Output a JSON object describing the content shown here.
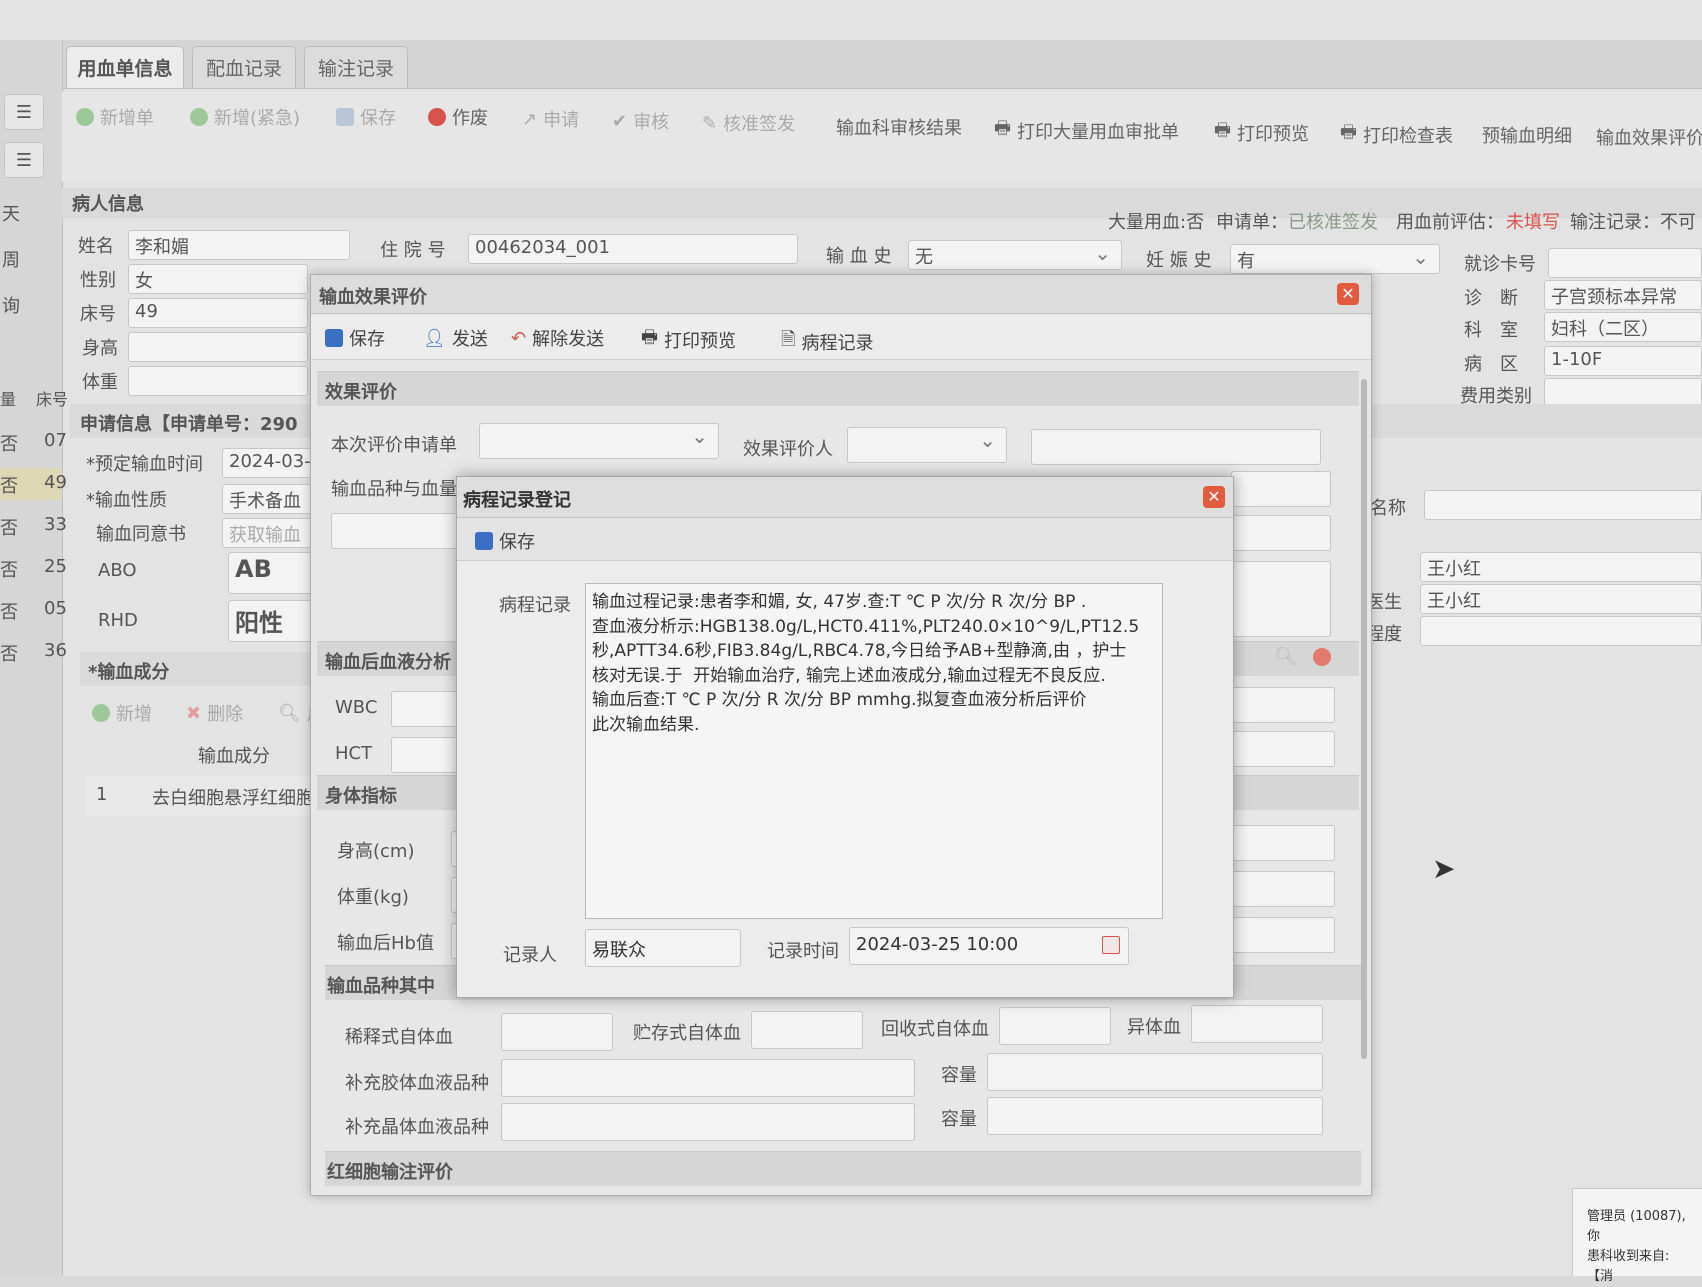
{
  "tabs": [
    "用血单信息",
    "配血记录",
    "输注记录"
  ],
  "sidebar": {
    "labels": [
      "天",
      "周",
      "询"
    ],
    "columns": [
      "量",
      "床号"
    ],
    "rows": [
      {
        "flag": "否",
        "bed": "07"
      },
      {
        "flag": "否",
        "bed": "49"
      },
      {
        "flag": "否",
        "bed": "33"
      },
      {
        "flag": "否",
        "bed": "25"
      },
      {
        "flag": "否",
        "bed": "05"
      },
      {
        "flag": "否",
        "bed": "36"
      }
    ]
  },
  "toolbar": {
    "new_order": "新增单",
    "new_urgent": "新增(紧急)",
    "save": "保存",
    "void": "作废",
    "apply": "申请",
    "review": "审核",
    "approve_sign": "核准签发",
    "dept_review_result": "输血科审核结果",
    "print_mass_approval": "打印大量用血审批单",
    "print_preview": "打印预览",
    "print_check_table": "打印检查表",
    "pre_transfusion_detail": "预输血明细",
    "effect_eval": "输血效果评价"
  },
  "patient": {
    "section_title": "病人信息",
    "status": {
      "mass_blood": "大量用血:否",
      "order_label": "申请单：",
      "order_value": "已核准签发",
      "pre_eval_label": "用血前评估：",
      "pre_eval_value": "未填写",
      "infusion_label": "输注记录：不可"
    },
    "name_label": "姓名",
    "name": "李和媚",
    "gender_label": "性别",
    "gender": "女",
    "bed_label": "床号",
    "bed": "49",
    "height_label": "身高",
    "weight_label": "体重",
    "admission_label": "住 院 号",
    "admission_no": "00462034_001",
    "transfusion_history_label": "输 血 史",
    "transfusion_history": "无",
    "pregnancy_label": "妊 娠 史",
    "pregnancy": "有",
    "card_label": "就诊卡号",
    "diagnosis_label": "诊　断",
    "diagnosis": "子宫颈标本异常",
    "dept_label": "科　室",
    "dept": "妇科（二区）",
    "ward_label": "病　区",
    "ward": "1-10F",
    "fee_label": "费用类别"
  },
  "application": {
    "section_title": "申请信息【申请单号：290",
    "planned_time_label": "*预定输血时间",
    "planned_time": "2024-03-",
    "nature_label": "*输血性质",
    "nature": "手术备血",
    "consent_label": "输血同意书",
    "consent": "获取输血",
    "abo_label": "ABO",
    "abo": "AB",
    "rhd_label": "RHD",
    "rhd": "阳性",
    "name_label": "名称",
    "doctor1": "王小红",
    "doctor_label": "医生",
    "doctor2": "王小红",
    "degree_label": "程度"
  },
  "components": {
    "section_title": "*输血成分",
    "add": "新增",
    "delete": "删除",
    "use": "用",
    "col_header": "输血成分",
    "rows": [
      {
        "index": "1",
        "name": "去白细胞悬浮红细胞"
      }
    ]
  },
  "effect_dialog": {
    "title": "输血效果评价",
    "save": "保存",
    "send": "发送",
    "unsend": "解除发送",
    "print_preview": "打印预览",
    "progress_record": "病程记录",
    "section_eval": "效果评价",
    "this_eval_order_label": "本次评价申请单",
    "evaluator_label": "效果评价人",
    "product_label": "输血品种与血量",
    "post_blood_section": "输血后血液分析",
    "wbc_label": "WBC",
    "hct_label": "HCT",
    "body_section": "身体指标",
    "height_label": "身高(cm)",
    "weight_label": "体重(kg)",
    "post_hb_label": "输血后Hb值",
    "product_section": "输血品种其中",
    "diluted_label": "稀释式自体血",
    "stored_label": "贮存式自体血",
    "recovered_label": "回收式自体血",
    "allogeneic_label": "异体血",
    "colloid_label": "补充胶体血液品种",
    "crystal_label": "补充晶体血液品种",
    "volume_label": "容量",
    "rbc_section": "红细胞输注评价"
  },
  "record_dialog": {
    "title": "病程记录登记",
    "save": "保存",
    "record_label": "病程记录",
    "record_text": "输血过程记录:患者李和媚, 女, 47岁.查:T ℃ P 次/分 R 次/分 BP .\n查血液分析示:HGB138.0g/L,HCT0.411%,PLT240.0×10^9/L,PT12.5\n秒,APTT34.6秒,FIB3.84g/L,RBC4.78,今日给予AB+型静滴,由 ，护士\n核对无误.于  开始输血治疗, 输完上述血液成分,输血过程无不良反应.\n输血后查:T ℃ P 次/分 R 次/分 BP mmhg.拟复查血液分析后评价\n此次输血结果.",
    "recorder_label": "记录人",
    "recorder": "易联众",
    "time_label": "记录时间",
    "time": "2024-03-25 10:00"
  },
  "statusbar": {
    "user": "管理员 (10087), 你",
    "message": "患科收到来自: 【消"
  },
  "colors": {
    "accent_red": "#d9534f",
    "close_red": "#e35b3f",
    "save_blue": "#3a6fc4"
  }
}
